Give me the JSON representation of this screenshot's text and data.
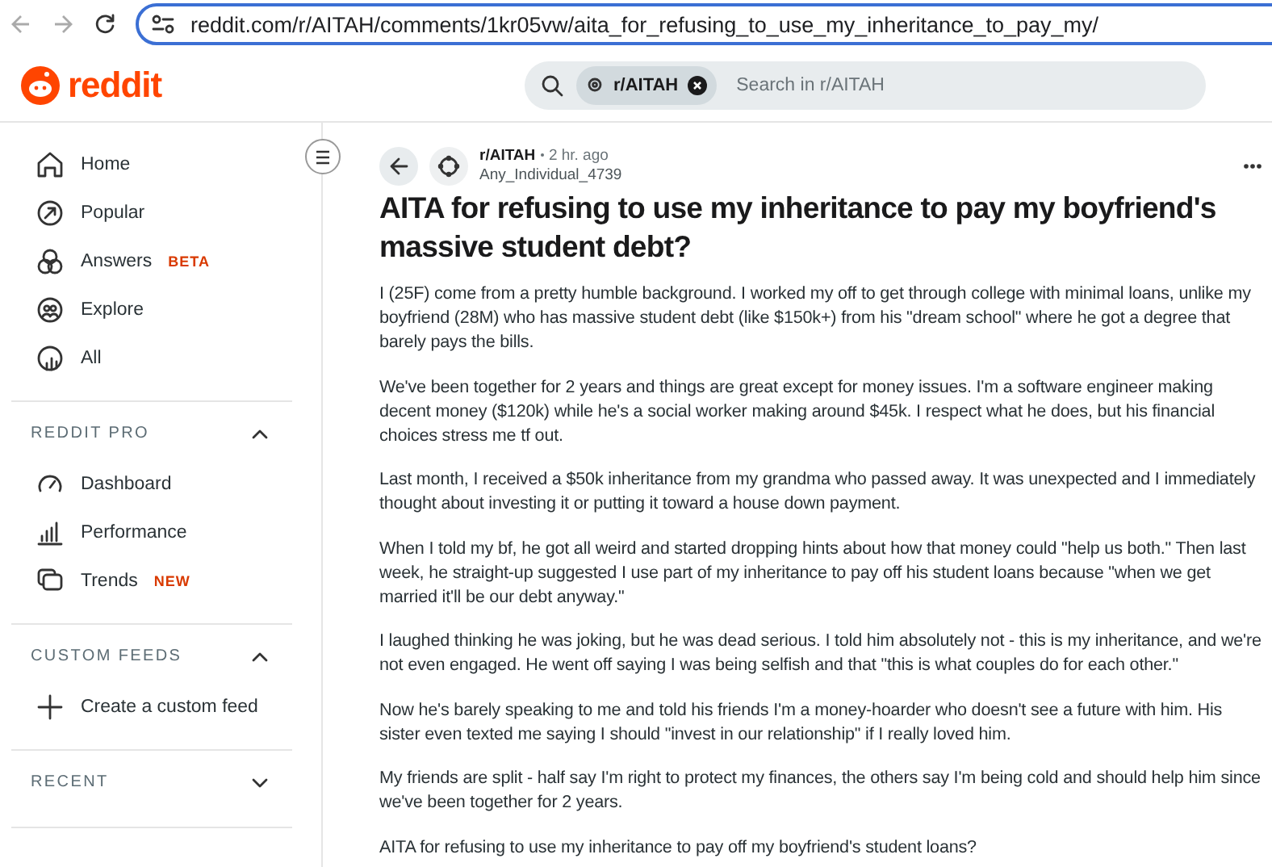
{
  "browser": {
    "url": "reddit.com/r/AITAH/comments/1kr05vw/aita_for_refusing_to_use_my_inheritance_to_pay_my/"
  },
  "header": {
    "logo": "reddit",
    "search": {
      "chip": "r/AITAH",
      "placeholder": "Search in r/AITAH"
    }
  },
  "sidebar": {
    "items": [
      {
        "label": "Home"
      },
      {
        "label": "Popular"
      },
      {
        "label": "Answers",
        "badge": "BETA"
      },
      {
        "label": "Explore"
      },
      {
        "label": "All"
      }
    ],
    "sections": [
      {
        "title": "REDDIT PRO",
        "expanded": true,
        "items": [
          {
            "label": "Dashboard"
          },
          {
            "label": "Performance"
          },
          {
            "label": "Trends",
            "badge": "NEW"
          }
        ]
      },
      {
        "title": "CUSTOM FEEDS",
        "expanded": true,
        "items": [
          {
            "label": "Create a custom feed"
          }
        ]
      },
      {
        "title": "RECENT",
        "expanded": false
      }
    ]
  },
  "post": {
    "subreddit": "r/AITAH",
    "time": "2 hr. ago",
    "author": "Any_Individual_4739",
    "title": "AITA for refusing to use my inheritance to pay my boyfriend's massive student debt?",
    "paragraphs": [
      "I (25F) come from a pretty humble background. I worked my off to get through college with minimal loans, unlike my boyfriend (28M) who has massive student debt (like $150k+) from his \"dream school\" where he got a degree that barely pays the bills.",
      "We've been together for 2 years and things are great except for money issues. I'm a software engineer making decent money ($120k) while he's a social worker making around $45k. I respect what he does, but his financial choices stress me tf out.",
      "Last month, I received a $50k inheritance from my grandma who passed away. It was unexpected and I immediately thought about investing it or putting it toward a house down payment.",
      "When I told my bf, he got all weird and started dropping hints about how that money could \"help us both.\" Then last week, he straight-up suggested I use part of my inheritance to pay off his student loans because \"when we get married it'll be our debt anyway.\"",
      "I laughed thinking he was joking, but he was dead serious. I told him absolutely not - this is my inheritance, and we're not even engaged. He went off saying I was being selfish and that \"this is what couples do for each other.\"",
      "Now he's barely speaking to me and told his friends I'm a money-hoarder who doesn't see a future with him. His sister even texted me saying I should \"invest in our relationship\" if I really loved him.",
      "My friends are split - half say I'm right to protect my finances, the others say I'm being cold and should help him since we've been together for 2 years.",
      "AITA for refusing to use my inheritance to pay off my boyfriend's student loans?"
    ]
  }
}
